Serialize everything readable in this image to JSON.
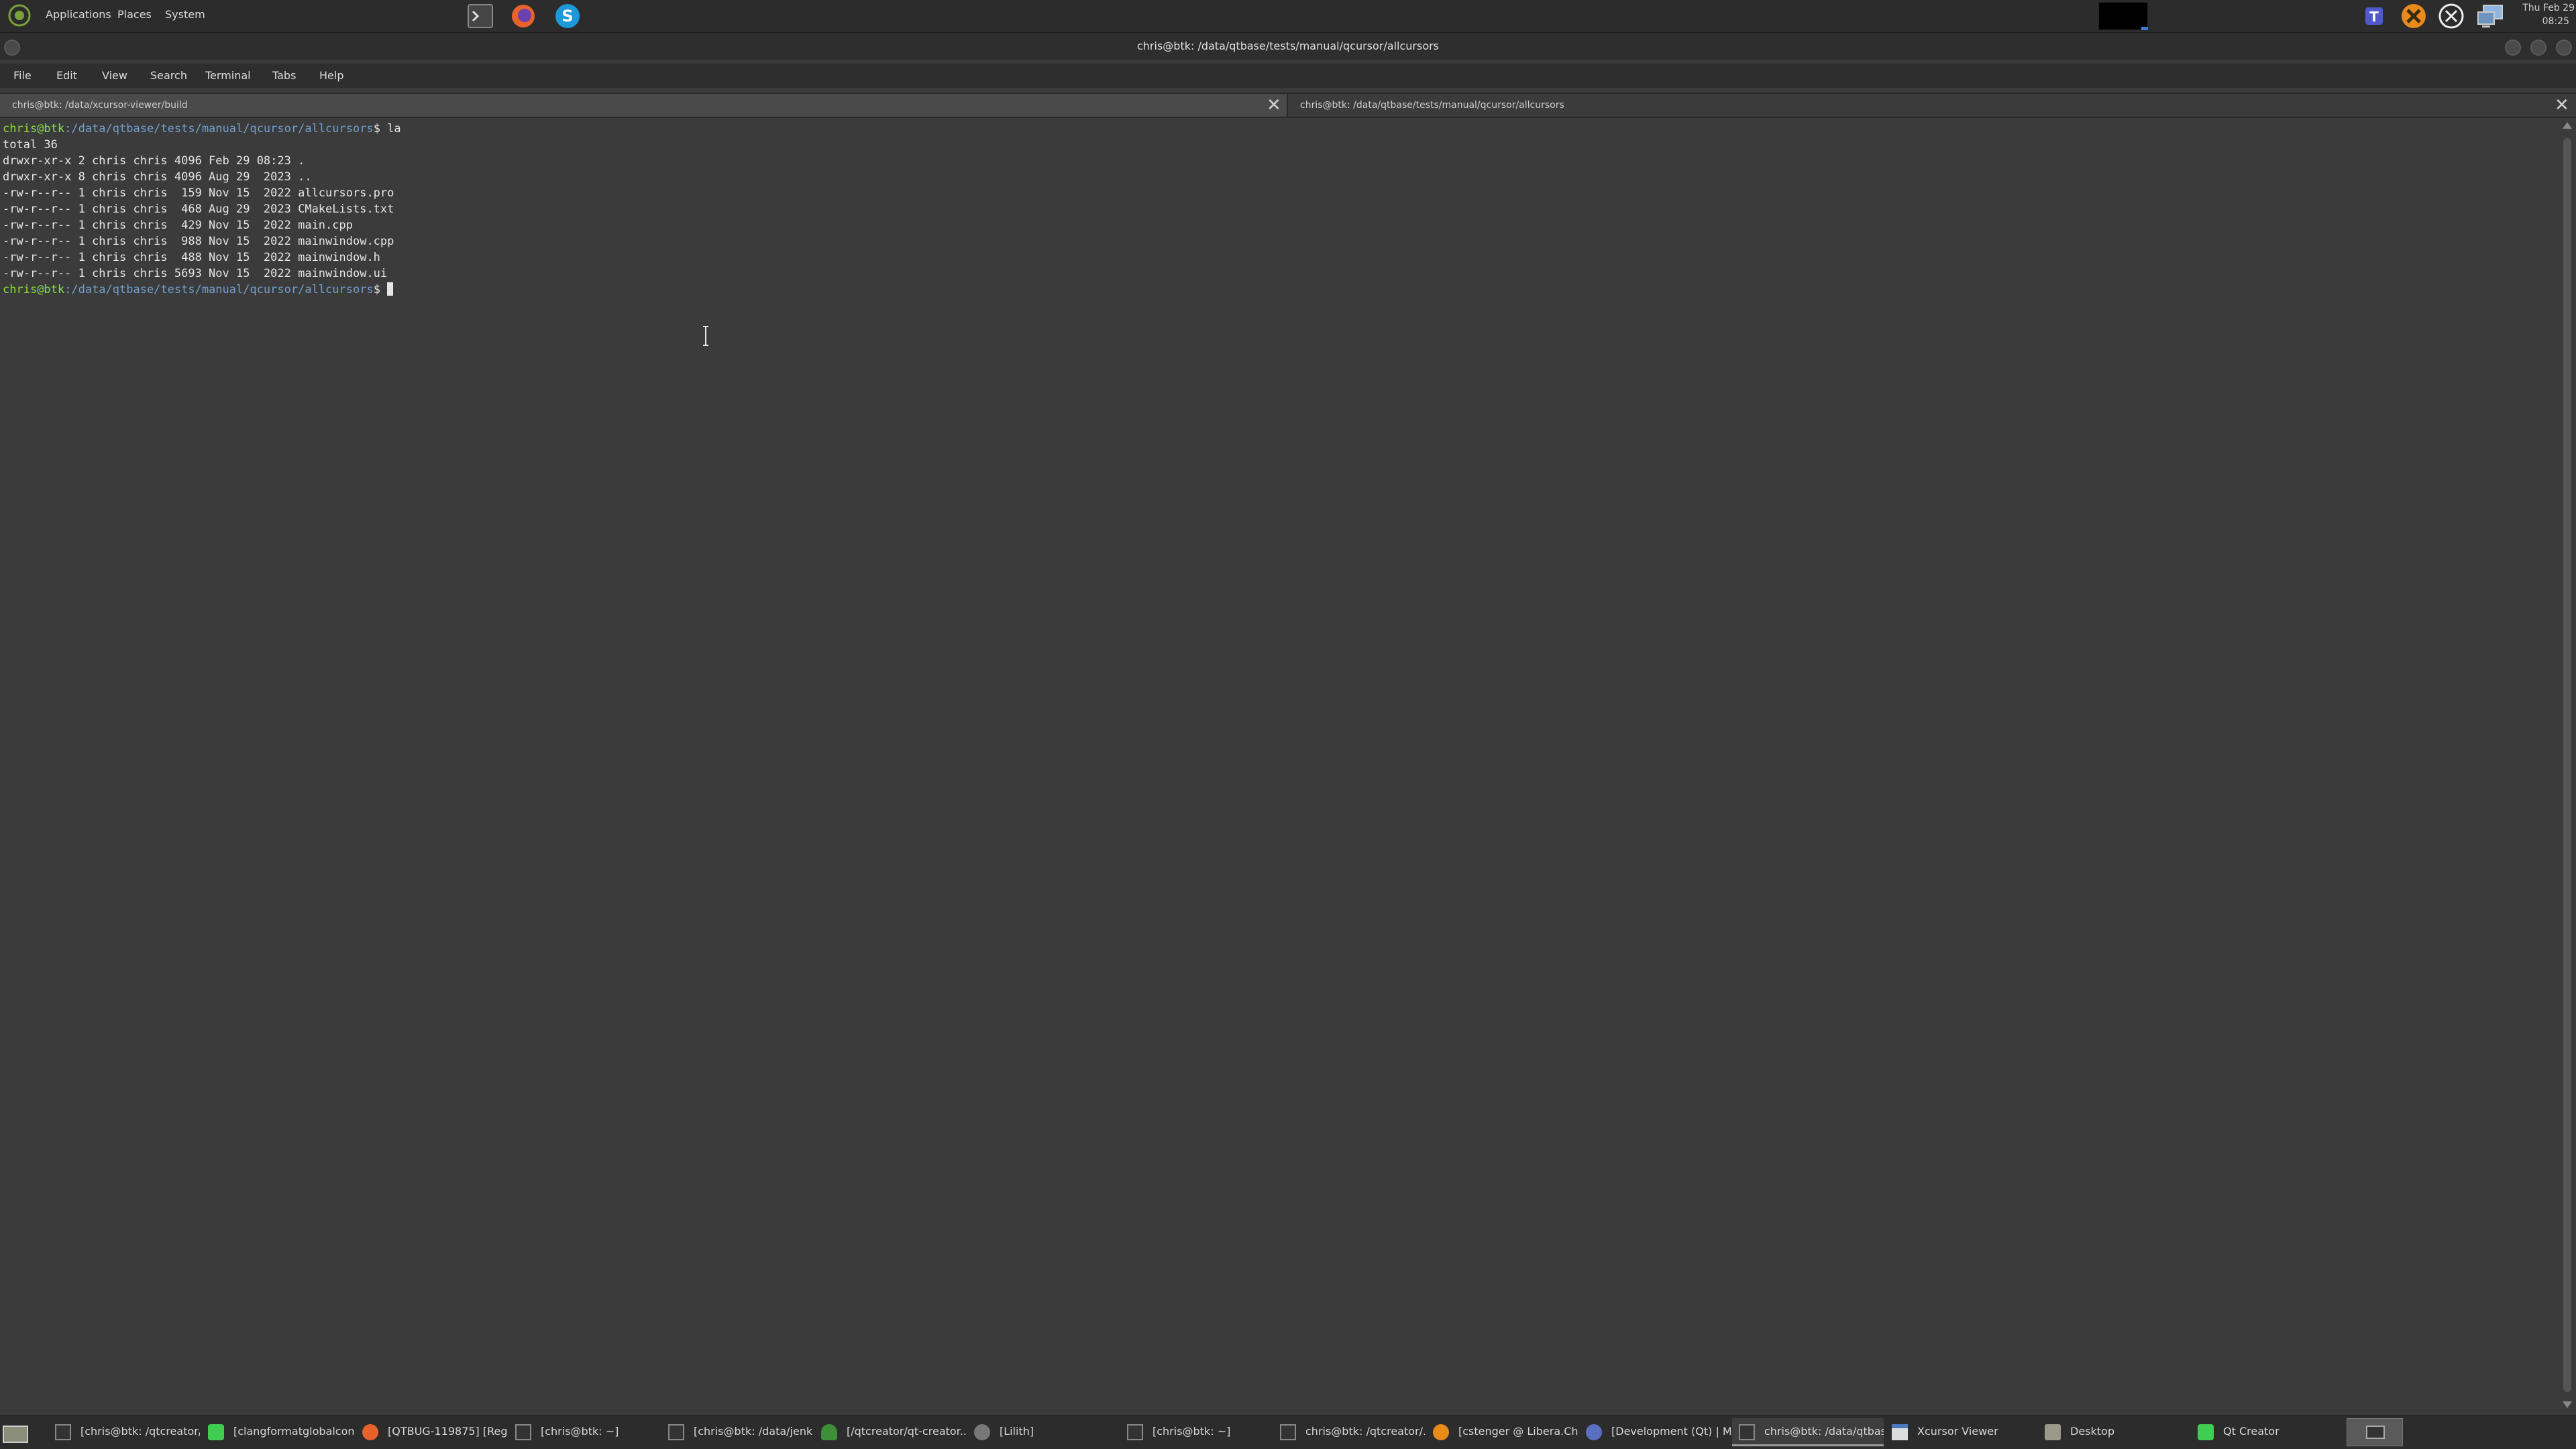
{
  "top_panel": {
    "menus": [
      "Applications",
      "Places",
      "System"
    ],
    "launchers": [
      "terminal-launcher-icon",
      "firefox-icon",
      "skype-icon"
    ],
    "tray_icons": [
      "teams-icon",
      "orange-x-icon",
      "no-entry-icon",
      "network-icon"
    ],
    "clock_day": "Thu Feb 29",
    "clock_time": "08:25"
  },
  "window": {
    "title": "chris@btk: /data/qtbase/tests/manual/qcursor/allcursors",
    "menu": [
      "File",
      "Edit",
      "View",
      "Search",
      "Terminal",
      "Tabs",
      "Help"
    ],
    "tabs": [
      {
        "label": "chris@btk: /data/xcursor-viewer/build",
        "active": false
      },
      {
        "label": "chris@btk: /data/qtbase/tests/manual/qcursor/allcursors",
        "active": true
      }
    ]
  },
  "terminal": {
    "prompt_user": "chris@btk",
    "prompt_path": ":/data/qtbase/tests/manual/qcursor/allcursors",
    "prompt_symbol": "$ ",
    "command": "la",
    "output": [
      "total 36",
      "drwxr-xr-x 2 chris chris 4096 Feb 29 08:23 .",
      "drwxr-xr-x 8 chris chris 4096 Aug 29  2023 ..",
      "-rw-r--r-- 1 chris chris  159 Nov 15  2022 allcursors.pro",
      "-rw-r--r-- 1 chris chris  468 Aug 29  2023 CMakeLists.txt",
      "-rw-r--r-- 1 chris chris  429 Nov 15  2022 main.cpp",
      "-rw-r--r-- 1 chris chris  988 Nov 15  2022 mainwindow.cpp",
      "-rw-r--r-- 1 chris chris  488 Nov 15  2022 mainwindow.h",
      "-rw-r--r-- 1 chris chris 5693 Nov 15  2022 mainwindow.ui"
    ]
  },
  "taskbar": {
    "tasks": [
      {
        "label": "[chris@btk: /qtcreator/...",
        "icon": "terminal-icon",
        "active": false
      },
      {
        "label": "[clangformatglobalcon...",
        "icon": "qtcreator-icon",
        "active": false
      },
      {
        "label": "[QTBUG-119875] [Reg...",
        "icon": "firefox-icon",
        "active": false
      },
      {
        "label": "[chris@btk: ~]",
        "icon": "terminal-icon",
        "active": false
      },
      {
        "label": "[chris@btk: /data/jenki...",
        "icon": "terminal-icon",
        "active": false
      },
      {
        "label": "[/qtcreator/qt-creator...",
        "icon": "tree-icon",
        "active": false
      },
      {
        "label": "[Lilith]",
        "icon": "disc-icon",
        "active": false
      },
      {
        "label": "[chris@btk: ~]",
        "icon": "terminal-icon",
        "active": false
      },
      {
        "label": "chris@btk: /qtcreator/...",
        "icon": "terminal-icon",
        "active": false
      },
      {
        "label": "[cstenger @ Libera.Ch...",
        "icon": "hexchat-icon",
        "active": false
      },
      {
        "label": "[Development (Qt) | M...",
        "icon": "chat-icon",
        "active": false
      },
      {
        "label": "chris@btk: /data/qtbas...",
        "icon": "terminal-icon",
        "active": true
      },
      {
        "label": "Xcursor Viewer",
        "icon": "window-icon",
        "active": false
      },
      {
        "label": "Desktop",
        "icon": "folder-icon",
        "active": false
      },
      {
        "label": "Qt Creator",
        "icon": "qtcreator-icon",
        "active": false
      }
    ]
  }
}
